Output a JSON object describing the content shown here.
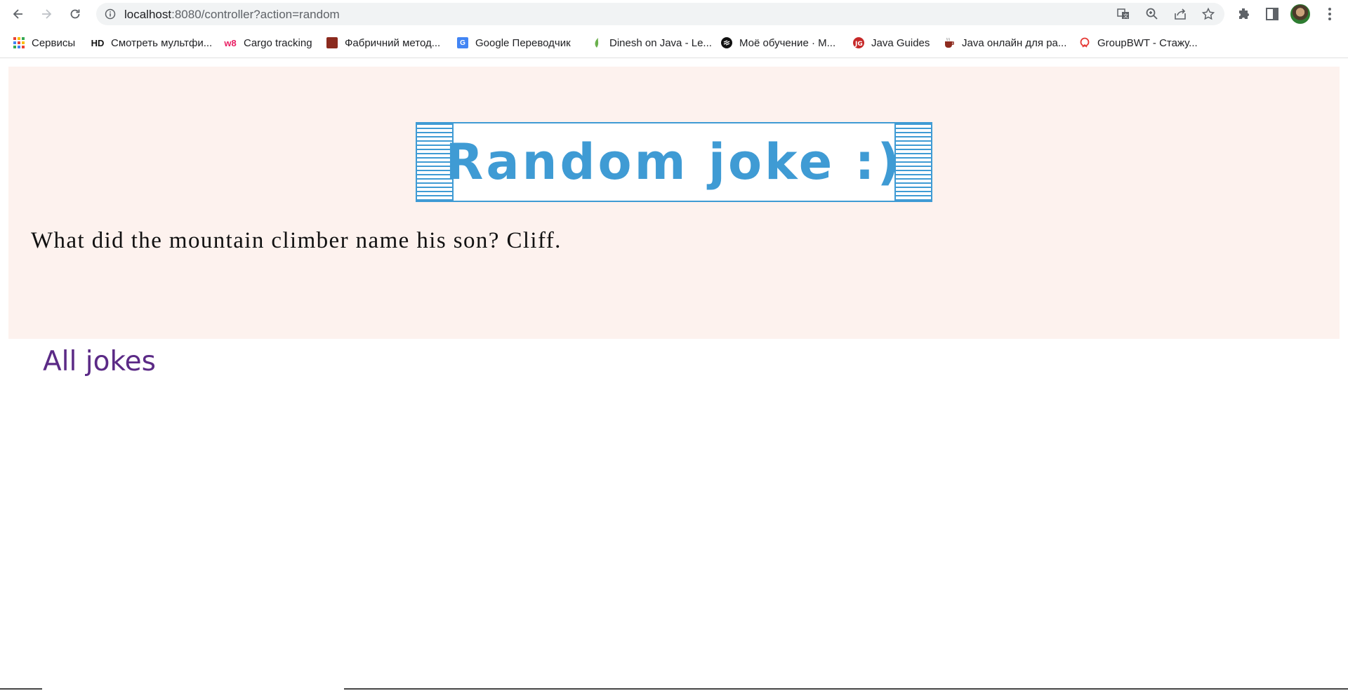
{
  "browser": {
    "url_host": "localhost",
    "url_rest": ":8080/controller?action=random"
  },
  "bookmarks": [
    {
      "label": "Сервисы",
      "icon": "apps-grid-icon"
    },
    {
      "label": "Смотреть мультфи...",
      "icon": "hd-icon",
      "icon_text": "HD"
    },
    {
      "label": "Cargo tracking",
      "icon": "w8-icon",
      "icon_text": "w8"
    },
    {
      "label": "Фабричний метод...",
      "icon": "factory-method-icon"
    },
    {
      "label": "Google Переводчик",
      "icon": "google-translate-icon"
    },
    {
      "label": "Dinesh on Java - Le...",
      "icon": "leaf-icon"
    },
    {
      "label": "Моё обучение · M...",
      "icon": "learning-icon"
    },
    {
      "label": "Java Guides",
      "icon": "java-guides-icon"
    },
    {
      "label": "Java онлайн для ра...",
      "icon": "coffee-cup-icon"
    },
    {
      "label": "GroupBWT - Стажу...",
      "icon": "groupbwt-icon"
    }
  ],
  "page": {
    "title": "Random joke :)",
    "joke": "What did the mountain climber name his son? Cliff.",
    "all_jokes_link": "All jokes"
  },
  "colors": {
    "panel_bg": "#fdf2ee",
    "title_blue": "#3f9bd4",
    "link_purple": "#5b2a86"
  }
}
